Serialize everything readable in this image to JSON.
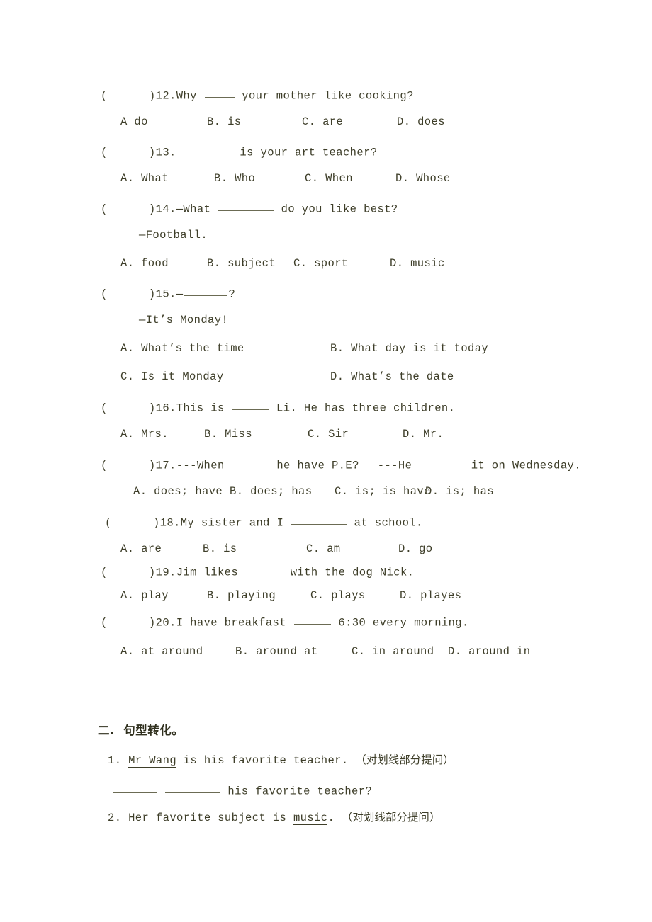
{
  "document": {
    "page_background": "#ffffff",
    "text_color": "#3e3e29",
    "rule_color": "#6b6b53"
  },
  "multiple_choice": {
    "questions": [
      {
        "bracket": "(      )",
        "number": "12.",
        "stem_before": "Why ",
        "stem_after": " your mother like cooking?",
        "options": [
          "A do",
          "B. is",
          "C. are",
          "D. does"
        ]
      },
      {
        "bracket": "(      )",
        "number": "13.",
        "stem_before": "",
        "stem_after": " is your art teacher?",
        "options": [
          "A. What",
          "B. Who",
          "C. When",
          "D. Whose"
        ]
      },
      {
        "bracket": "(      )",
        "number": "14.",
        "stem_before": "—What ",
        "stem_after": " do you like best?",
        "answer_line": "—Football.",
        "options": [
          "A. food",
          "B. subject",
          "C. sport",
          "D. music"
        ]
      },
      {
        "bracket": "(      )",
        "number": "15.",
        "stem_before": "—",
        "stem_after": "?",
        "answer_line": "—It’s Monday!",
        "options": [
          "A. What’s the time",
          "B. What day is it today",
          "C. Is it Monday",
          "D. What’s the date"
        ]
      },
      {
        "bracket": "(      )",
        "number": "16.",
        "stem_before": "This is ",
        "stem_after": " Li. He has three children.",
        "options": [
          "A. Mrs.",
          "B. Miss",
          "C. Sir",
          "D. Mr."
        ]
      },
      {
        "bracket": "(      )",
        "number": "17.",
        "stem_part1": "---When ",
        "stem_part2": "he have P.E?",
        "stem_part3": "---He ",
        "stem_part4": " it on Wednesday.",
        "options": [
          "A. does; have",
          "B. does; has",
          "C. is; is have",
          "D. is; has"
        ]
      },
      {
        "bracket": "(      )",
        "number": "18.",
        "stem_before": "My sister and I ",
        "stem_after": " at school.",
        "options": [
          "A. are",
          "B. is",
          "C. am",
          "D. go"
        ]
      },
      {
        "bracket": "(      )",
        "number": "19.",
        "stem_before": "Jim likes ",
        "stem_after": "with the dog Nick.",
        "options": [
          "A. play",
          "B. playing",
          "C. plays",
          "D. playes"
        ]
      },
      {
        "bracket": "(      )",
        "number": "20.",
        "stem_before": "I have breakfast ",
        "stem_after": " 6:30 every morning.",
        "options": [
          "A. at around",
          "B. around at",
          "C. in around",
          "D. around in"
        ]
      }
    ]
  },
  "section_two": {
    "heading": "二.  句型转化。",
    "items": [
      {
        "number": "1.",
        "underlined": "Mr Wang",
        "rest": " is his favorite teacher.",
        "hint": "（对划线部分提问）",
        "answer_tail": " his favorite teacher?"
      },
      {
        "number": "2.",
        "prefix": "Her favorite subject is ",
        "underlined": "music",
        "rest": ".",
        "hint": "（对划线部分提问）"
      }
    ]
  }
}
